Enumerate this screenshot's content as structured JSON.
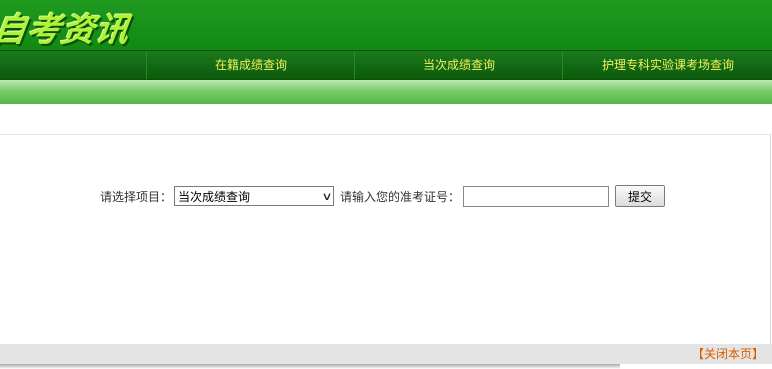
{
  "header": {
    "logo_text": "自考资讯"
  },
  "nav": {
    "items": [
      {
        "label": "在籍成绩查询"
      },
      {
        "label": "当次成绩查询"
      },
      {
        "label": "护理专科实验课考场查询"
      }
    ]
  },
  "form": {
    "select_label": "请选择项目：",
    "select_value": "当次成绩查询",
    "input_label": "请输入您的准考证号：",
    "input_value": "",
    "submit_label": "提交"
  },
  "footer": {
    "close_label": "【关闭本页】"
  },
  "colors": {
    "header_green": "#1f9a1f",
    "nav_green": "#0b5a0b",
    "nav_text": "#f0f060",
    "logo": "#aef23a",
    "close_link": "#e05a00"
  },
  "icons": {
    "select_arrow": "chevron-down-icon"
  }
}
